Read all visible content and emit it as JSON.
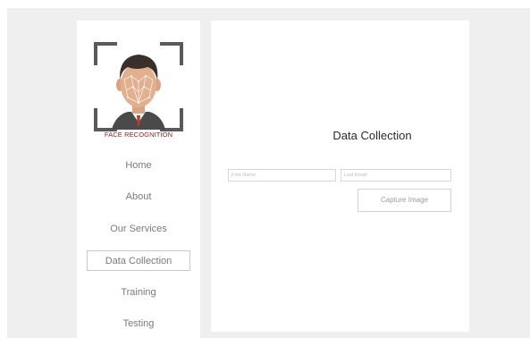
{
  "sidebar": {
    "logo": {
      "icon": "face-recognition-icon",
      "caption": "FACE RECOGNITION"
    },
    "items": [
      {
        "label": "Home",
        "active": false
      },
      {
        "label": "About",
        "active": false
      },
      {
        "label": "Our Services",
        "active": false
      },
      {
        "label": "Data Collection",
        "active": true
      },
      {
        "label": "Training",
        "active": false
      },
      {
        "label": "Testing",
        "active": false
      }
    ]
  },
  "main": {
    "title": "Data Collection",
    "form": {
      "first_name_placeholder": "First Name",
      "last_email_placeholder": "Last Email",
      "capture_label": "Capture Image"
    }
  },
  "colors": {
    "background": "#efefef",
    "accent": "#8b1d1d",
    "tie": "#c0392b"
  }
}
